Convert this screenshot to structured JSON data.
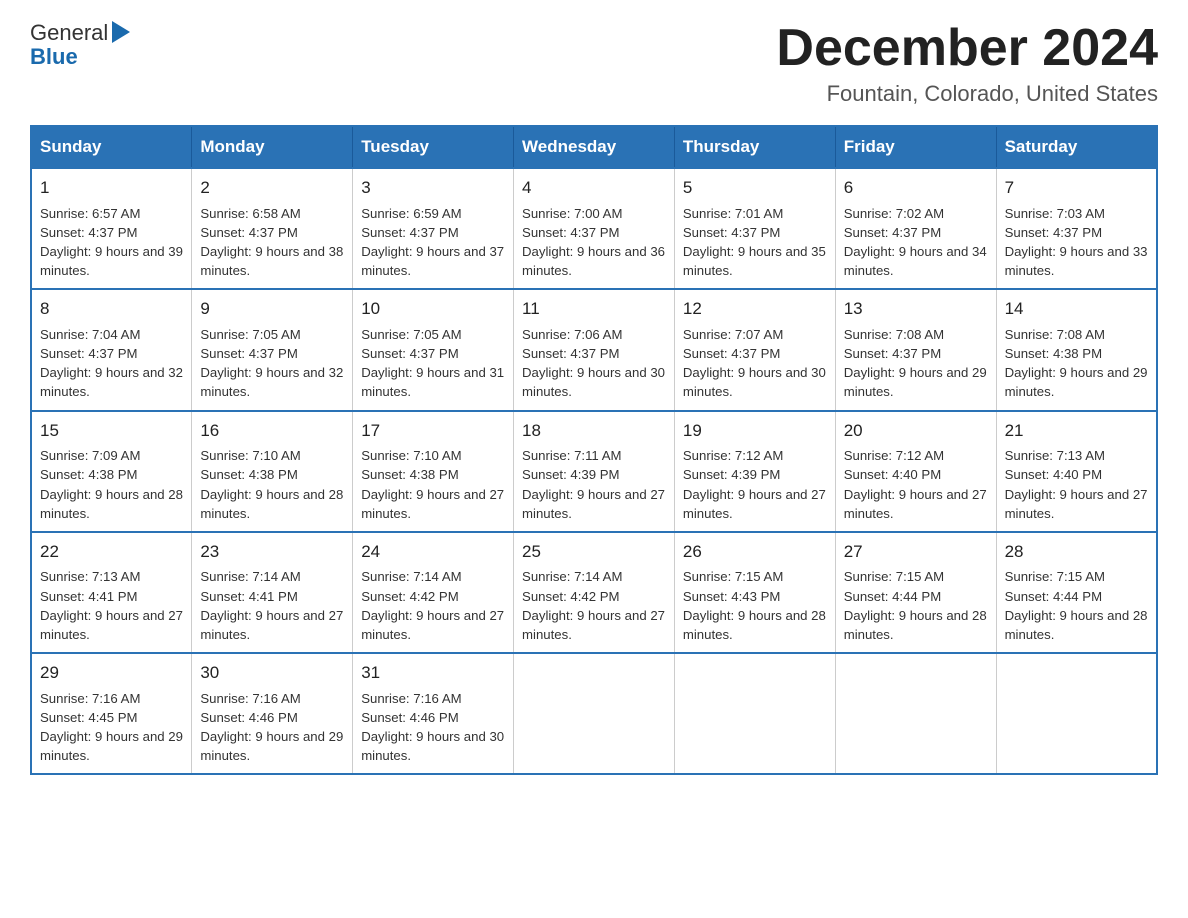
{
  "header": {
    "logo_general": "General",
    "logo_blue": "Blue",
    "month_title": "December 2024",
    "subtitle": "Fountain, Colorado, United States"
  },
  "days_of_week": [
    "Sunday",
    "Monday",
    "Tuesday",
    "Wednesday",
    "Thursday",
    "Friday",
    "Saturday"
  ],
  "weeks": [
    [
      {
        "day": "1",
        "sunrise": "6:57 AM",
        "sunset": "4:37 PM",
        "daylight": "9 hours and 39 minutes."
      },
      {
        "day": "2",
        "sunrise": "6:58 AM",
        "sunset": "4:37 PM",
        "daylight": "9 hours and 38 minutes."
      },
      {
        "day": "3",
        "sunrise": "6:59 AM",
        "sunset": "4:37 PM",
        "daylight": "9 hours and 37 minutes."
      },
      {
        "day": "4",
        "sunrise": "7:00 AM",
        "sunset": "4:37 PM",
        "daylight": "9 hours and 36 minutes."
      },
      {
        "day": "5",
        "sunrise": "7:01 AM",
        "sunset": "4:37 PM",
        "daylight": "9 hours and 35 minutes."
      },
      {
        "day": "6",
        "sunrise": "7:02 AM",
        "sunset": "4:37 PM",
        "daylight": "9 hours and 34 minutes."
      },
      {
        "day": "7",
        "sunrise": "7:03 AM",
        "sunset": "4:37 PM",
        "daylight": "9 hours and 33 minutes."
      }
    ],
    [
      {
        "day": "8",
        "sunrise": "7:04 AM",
        "sunset": "4:37 PM",
        "daylight": "9 hours and 32 minutes."
      },
      {
        "day": "9",
        "sunrise": "7:05 AM",
        "sunset": "4:37 PM",
        "daylight": "9 hours and 32 minutes."
      },
      {
        "day": "10",
        "sunrise": "7:05 AM",
        "sunset": "4:37 PM",
        "daylight": "9 hours and 31 minutes."
      },
      {
        "day": "11",
        "sunrise": "7:06 AM",
        "sunset": "4:37 PM",
        "daylight": "9 hours and 30 minutes."
      },
      {
        "day": "12",
        "sunrise": "7:07 AM",
        "sunset": "4:37 PM",
        "daylight": "9 hours and 30 minutes."
      },
      {
        "day": "13",
        "sunrise": "7:08 AM",
        "sunset": "4:37 PM",
        "daylight": "9 hours and 29 minutes."
      },
      {
        "day": "14",
        "sunrise": "7:08 AM",
        "sunset": "4:38 PM",
        "daylight": "9 hours and 29 minutes."
      }
    ],
    [
      {
        "day": "15",
        "sunrise": "7:09 AM",
        "sunset": "4:38 PM",
        "daylight": "9 hours and 28 minutes."
      },
      {
        "day": "16",
        "sunrise": "7:10 AM",
        "sunset": "4:38 PM",
        "daylight": "9 hours and 28 minutes."
      },
      {
        "day": "17",
        "sunrise": "7:10 AM",
        "sunset": "4:38 PM",
        "daylight": "9 hours and 27 minutes."
      },
      {
        "day": "18",
        "sunrise": "7:11 AM",
        "sunset": "4:39 PM",
        "daylight": "9 hours and 27 minutes."
      },
      {
        "day": "19",
        "sunrise": "7:12 AM",
        "sunset": "4:39 PM",
        "daylight": "9 hours and 27 minutes."
      },
      {
        "day": "20",
        "sunrise": "7:12 AM",
        "sunset": "4:40 PM",
        "daylight": "9 hours and 27 minutes."
      },
      {
        "day": "21",
        "sunrise": "7:13 AM",
        "sunset": "4:40 PM",
        "daylight": "9 hours and 27 minutes."
      }
    ],
    [
      {
        "day": "22",
        "sunrise": "7:13 AM",
        "sunset": "4:41 PM",
        "daylight": "9 hours and 27 minutes."
      },
      {
        "day": "23",
        "sunrise": "7:14 AM",
        "sunset": "4:41 PM",
        "daylight": "9 hours and 27 minutes."
      },
      {
        "day": "24",
        "sunrise": "7:14 AM",
        "sunset": "4:42 PM",
        "daylight": "9 hours and 27 minutes."
      },
      {
        "day": "25",
        "sunrise": "7:14 AM",
        "sunset": "4:42 PM",
        "daylight": "9 hours and 27 minutes."
      },
      {
        "day": "26",
        "sunrise": "7:15 AM",
        "sunset": "4:43 PM",
        "daylight": "9 hours and 28 minutes."
      },
      {
        "day": "27",
        "sunrise": "7:15 AM",
        "sunset": "4:44 PM",
        "daylight": "9 hours and 28 minutes."
      },
      {
        "day": "28",
        "sunrise": "7:15 AM",
        "sunset": "4:44 PM",
        "daylight": "9 hours and 28 minutes."
      }
    ],
    [
      {
        "day": "29",
        "sunrise": "7:16 AM",
        "sunset": "4:45 PM",
        "daylight": "9 hours and 29 minutes."
      },
      {
        "day": "30",
        "sunrise": "7:16 AM",
        "sunset": "4:46 PM",
        "daylight": "9 hours and 29 minutes."
      },
      {
        "day": "31",
        "sunrise": "7:16 AM",
        "sunset": "4:46 PM",
        "daylight": "9 hours and 30 minutes."
      },
      null,
      null,
      null,
      null
    ]
  ],
  "labels": {
    "sunrise_prefix": "Sunrise: ",
    "sunset_prefix": "Sunset: ",
    "daylight_prefix": "Daylight: "
  }
}
